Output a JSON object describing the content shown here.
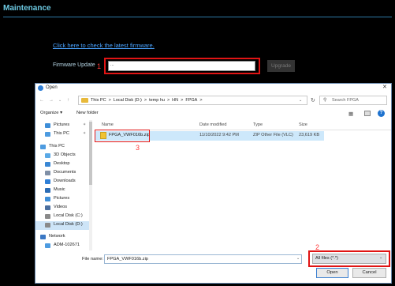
{
  "page": {
    "title": "Maintenance",
    "firmware_link": "Click here to check the latest firmware.",
    "firmware_label": "Firmware Update",
    "firmware_value": "...",
    "upgrade_label": "Upgrade",
    "markers": {
      "m1": "1",
      "m2": "2",
      "m3": "3"
    }
  },
  "dialog": {
    "title": "Open",
    "close_glyph": "✕",
    "breadcrumbs": [
      "This PC",
      ">",
      "Local Disk (D:)",
      ">",
      "temp hu",
      ">",
      "HN",
      ">",
      "FPGA",
      ">"
    ],
    "search_placeholder": "Search FPGA",
    "organize_label": "Organize ▾",
    "new_folder_label": "New folder",
    "nav_items": [
      {
        "label": "Pictures",
        "icon": "pictures-icon",
        "pinned": true
      },
      {
        "label": "This PC",
        "icon": "computer-icon",
        "pinned": true
      },
      {
        "label": "This PC",
        "icon": "computer-icon",
        "pinned": false
      },
      {
        "label": "3D Objects",
        "icon": "cube-icon",
        "pinned": false
      },
      {
        "label": "Desktop",
        "icon": "desktop-icon",
        "pinned": false
      },
      {
        "label": "Documents",
        "icon": "documents-icon",
        "pinned": false
      },
      {
        "label": "Downloads",
        "icon": "downloads-icon",
        "pinned": false
      },
      {
        "label": "Music",
        "icon": "music-icon",
        "pinned": false
      },
      {
        "label": "Pictures",
        "icon": "pictures-icon",
        "pinned": false
      },
      {
        "label": "Videos",
        "icon": "videos-icon",
        "pinned": false
      },
      {
        "label": "Local Disk (C:)",
        "icon": "disk-icon",
        "pinned": false
      },
      {
        "label": "Local Disk (D:)",
        "icon": "disk-icon",
        "pinned": false,
        "selected": true
      },
      {
        "label": "Network",
        "icon": "network-icon",
        "pinned": false
      },
      {
        "label": "ADM-102671",
        "icon": "computer-icon",
        "pinned": false
      }
    ],
    "columns": [
      "Name",
      "Date modified",
      "Type",
      "Size"
    ],
    "files": [
      {
        "name": "FPGA_VWF016b.zip",
        "date": "11/10/2022 9:42 PM",
        "type": "ZIP Other File (VLC)",
        "size": "23,619 KB"
      }
    ],
    "filename_label": "File name:",
    "filename_value": "FPGA_VWF016b.zip",
    "filetype_value": "All files (*.*)",
    "open_label": "Open",
    "cancel_label": "Cancel"
  },
  "colors": {
    "accent": "#6ecbe4",
    "highlight": "#e01414",
    "selection": "#cde8fb"
  }
}
